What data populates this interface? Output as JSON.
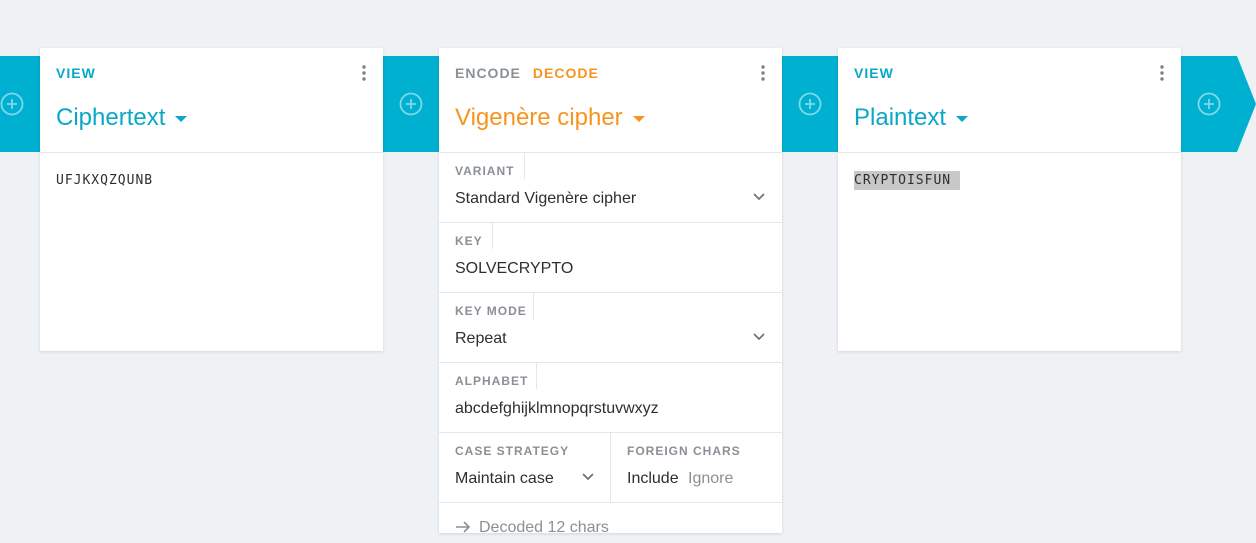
{
  "colors": {
    "band": "#00b0d0",
    "view_blue": "#0aa7c9",
    "orange": "#f7941d",
    "muted": "#8a9096"
  },
  "card1": {
    "mode": "VIEW",
    "title": "Ciphertext",
    "content": "UFJKXQZQUNB"
  },
  "card2": {
    "tab_encode": "ENCODE",
    "tab_decode": "DECODE",
    "title": "Vigenère cipher",
    "variant_label": "VARIANT",
    "variant_value": "Standard Vigenère cipher",
    "key_label": "KEY",
    "key_value": "SOLVECRYPTO",
    "keymode_label": "KEY MODE",
    "keymode_value": "Repeat",
    "alphabet_label": "ALPHABET",
    "alphabet_value": "abcdefghijklmnopqrstuvwxyz",
    "case_label": "CASE STRATEGY",
    "case_value": "Maintain case",
    "foreign_label": "FOREIGN CHARS",
    "foreign_include": "Include",
    "foreign_ignore": "Ignore",
    "status": "Decoded 12 chars"
  },
  "card3": {
    "mode": "VIEW",
    "title": "Plaintext",
    "content": "CRYPTOISFUN"
  }
}
